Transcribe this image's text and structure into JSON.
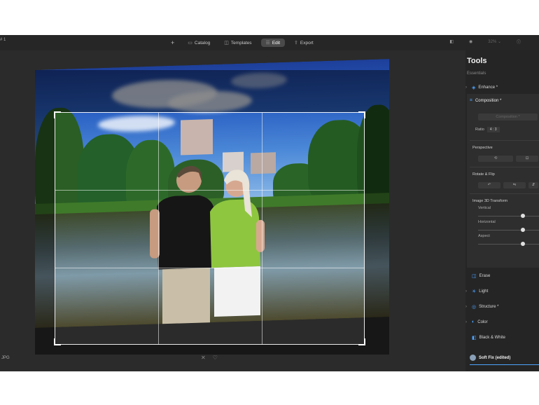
{
  "app": {
    "left_label": "# 1",
    "nav": {
      "add_icon": "plus-icon",
      "items": [
        {
          "label": "Catalog",
          "icon": "folder-icon",
          "active": false
        },
        {
          "label": "Templates",
          "icon": "templates-icon",
          "active": false
        },
        {
          "label": "Edit",
          "icon": "sliders-icon",
          "active": true
        },
        {
          "label": "Export",
          "icon": "export-icon",
          "active": false
        }
      ]
    },
    "top_right": {
      "zoom": "32%",
      "zoom_caret": "⌄"
    }
  },
  "canvas": {
    "filename": "JPG",
    "close_glyph": "✕",
    "heart_glyph": "♡"
  },
  "panel": {
    "title": "Tools",
    "subtitle": "Essentials",
    "sections": {
      "enhance": "Enhance *",
      "composition": "Composition *",
      "erase": "Erase",
      "light": "Light",
      "structure": "Structure *",
      "color": "Color",
      "bw": "Black & White"
    },
    "composition": {
      "aspect_button": "Composition *",
      "ratio_label": "Ratio",
      "ratio_value": "4 : 3",
      "perspective_label": "Perspective",
      "rotate_label": "Rotate & Flip",
      "transform_label": "Image 3D Transform",
      "sliders": [
        {
          "label": "Vertical",
          "value": 0.75
        },
        {
          "label": "Horizontal",
          "value": 0.75
        },
        {
          "label": "Aspect",
          "value": 0.75
        }
      ]
    },
    "preset": "Soft Fix (edited)"
  },
  "colors": {
    "accent": "#4da3ff",
    "background": "#2b2b2b",
    "panel": "#252525"
  }
}
